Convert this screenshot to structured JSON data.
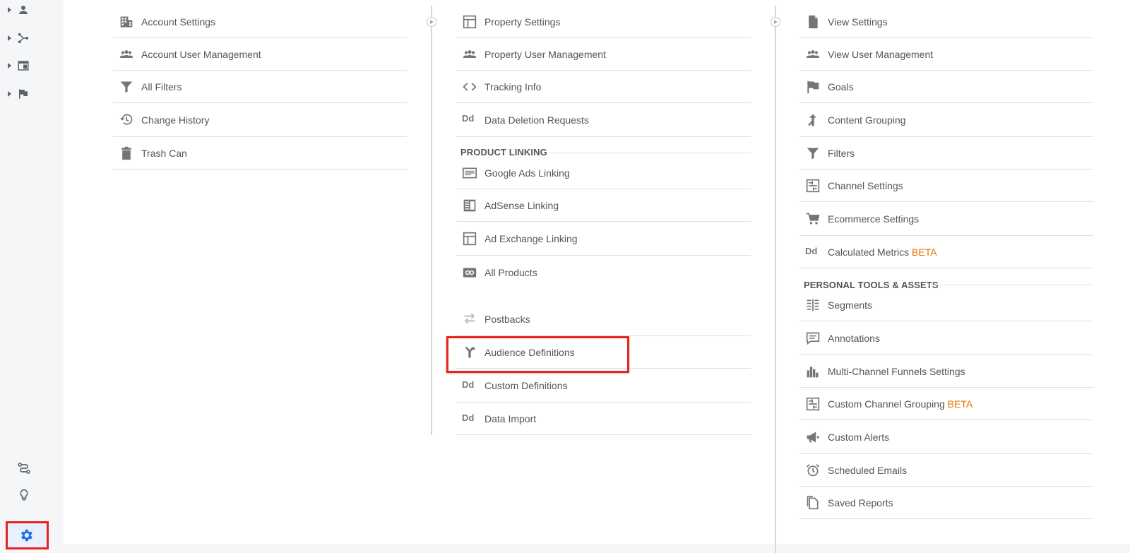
{
  "account_column": {
    "items": [
      {
        "label": "Account Settings",
        "icon": "building-icon"
      },
      {
        "label": "Account User Management",
        "icon": "users-icon"
      },
      {
        "label": "All Filters",
        "icon": "filter-icon"
      },
      {
        "label": "Change History",
        "icon": "history-icon"
      },
      {
        "label": "Trash Can",
        "icon": "trash-icon"
      }
    ]
  },
  "property_column": {
    "items": [
      {
        "label": "Property Settings",
        "icon": "property-icon"
      },
      {
        "label": "Property User Management",
        "icon": "users-icon"
      },
      {
        "label": "Tracking Info",
        "icon": "code-icon"
      },
      {
        "label": "Data Deletion Requests",
        "icon": "dd-icon"
      }
    ],
    "section_title": "PRODUCT LINKING",
    "linking_items": [
      {
        "label": "Google Ads Linking",
        "icon": "google-ads-icon"
      },
      {
        "label": "AdSense Linking",
        "icon": "adsense-icon"
      },
      {
        "label": "Ad Exchange Linking",
        "icon": "ad-exchange-icon"
      },
      {
        "label": "All Products",
        "icon": "link-icon"
      }
    ],
    "other_items": [
      {
        "label": "Postbacks",
        "icon": "postbacks-icon"
      },
      {
        "label": "Audience Definitions",
        "icon": "audience-icon"
      },
      {
        "label": "Custom Definitions",
        "icon": "dd-icon"
      },
      {
        "label": "Data Import",
        "icon": "dd-icon"
      }
    ]
  },
  "view_column": {
    "items": [
      {
        "label": "View Settings",
        "icon": "document-icon"
      },
      {
        "label": "View User Management",
        "icon": "users-icon"
      },
      {
        "label": "Goals",
        "icon": "flag-icon"
      },
      {
        "label": "Content Grouping",
        "icon": "content-grouping-icon"
      },
      {
        "label": "Filters",
        "icon": "filter-icon"
      },
      {
        "label": "Channel Settings",
        "icon": "channel-icon"
      },
      {
        "label": "Ecommerce Settings",
        "icon": "cart-icon"
      },
      {
        "label": "Calculated Metrics",
        "icon": "dd-icon",
        "badge": "BETA"
      }
    ],
    "section_title": "PERSONAL TOOLS & ASSETS",
    "personal_items": [
      {
        "label": "Segments",
        "icon": "segments-icon"
      },
      {
        "label": "Annotations",
        "icon": "annotation-icon"
      },
      {
        "label": "Multi-Channel Funnels Settings",
        "icon": "bar-chart-icon"
      },
      {
        "label": "Custom Channel Grouping",
        "icon": "channel-icon",
        "badge": "BETA"
      },
      {
        "label": "Custom Alerts",
        "icon": "megaphone-icon"
      },
      {
        "label": "Scheduled Emails",
        "icon": "alarm-icon"
      },
      {
        "label": "Saved Reports",
        "icon": "saved-reports-icon"
      }
    ]
  },
  "dd_text": "Dd",
  "colors": {
    "highlight": "#e8231d",
    "beta": "#e37400",
    "active": "#1a73e8"
  }
}
